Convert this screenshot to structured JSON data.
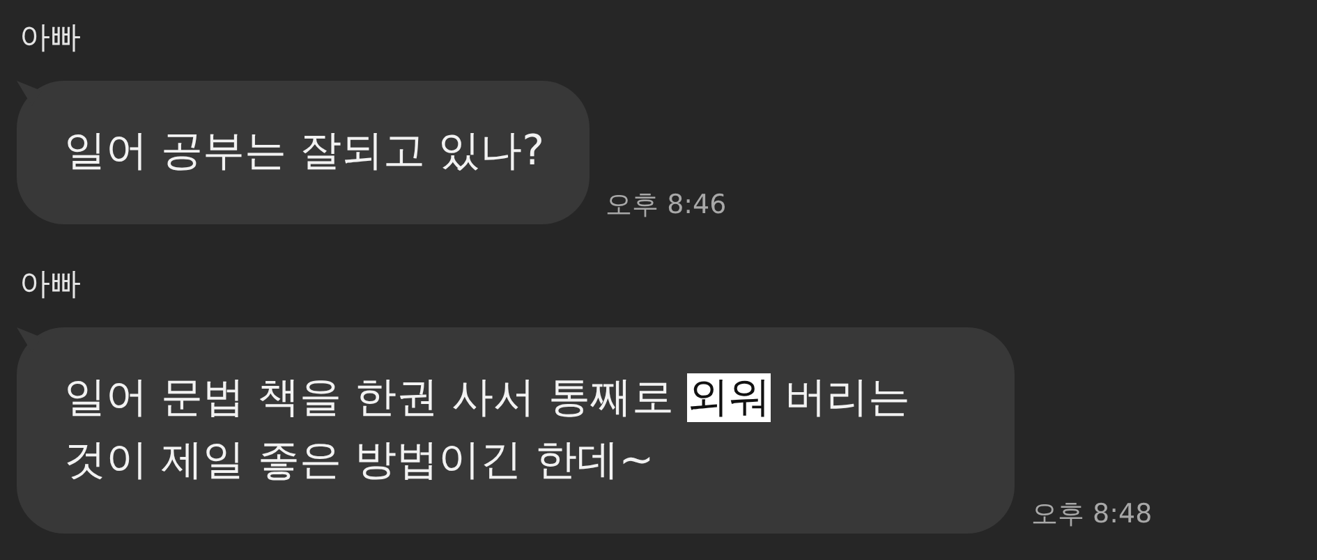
{
  "messages": [
    {
      "sender": "아빠",
      "segments": [
        {
          "text": "일어 공부는 잘되고 있나?",
          "highlighted": false
        }
      ],
      "time": "오후 8:46"
    },
    {
      "sender": "아빠",
      "segments": [
        {
          "text": "일어 문법 책을 한권 사서 통째로 ",
          "highlighted": false
        },
        {
          "text": "외워",
          "highlighted": true
        },
        {
          "text": " 버리는 것이 제일 좋은 방법이긴 한데~",
          "highlighted": false
        }
      ],
      "time": "오후 8:48"
    }
  ]
}
